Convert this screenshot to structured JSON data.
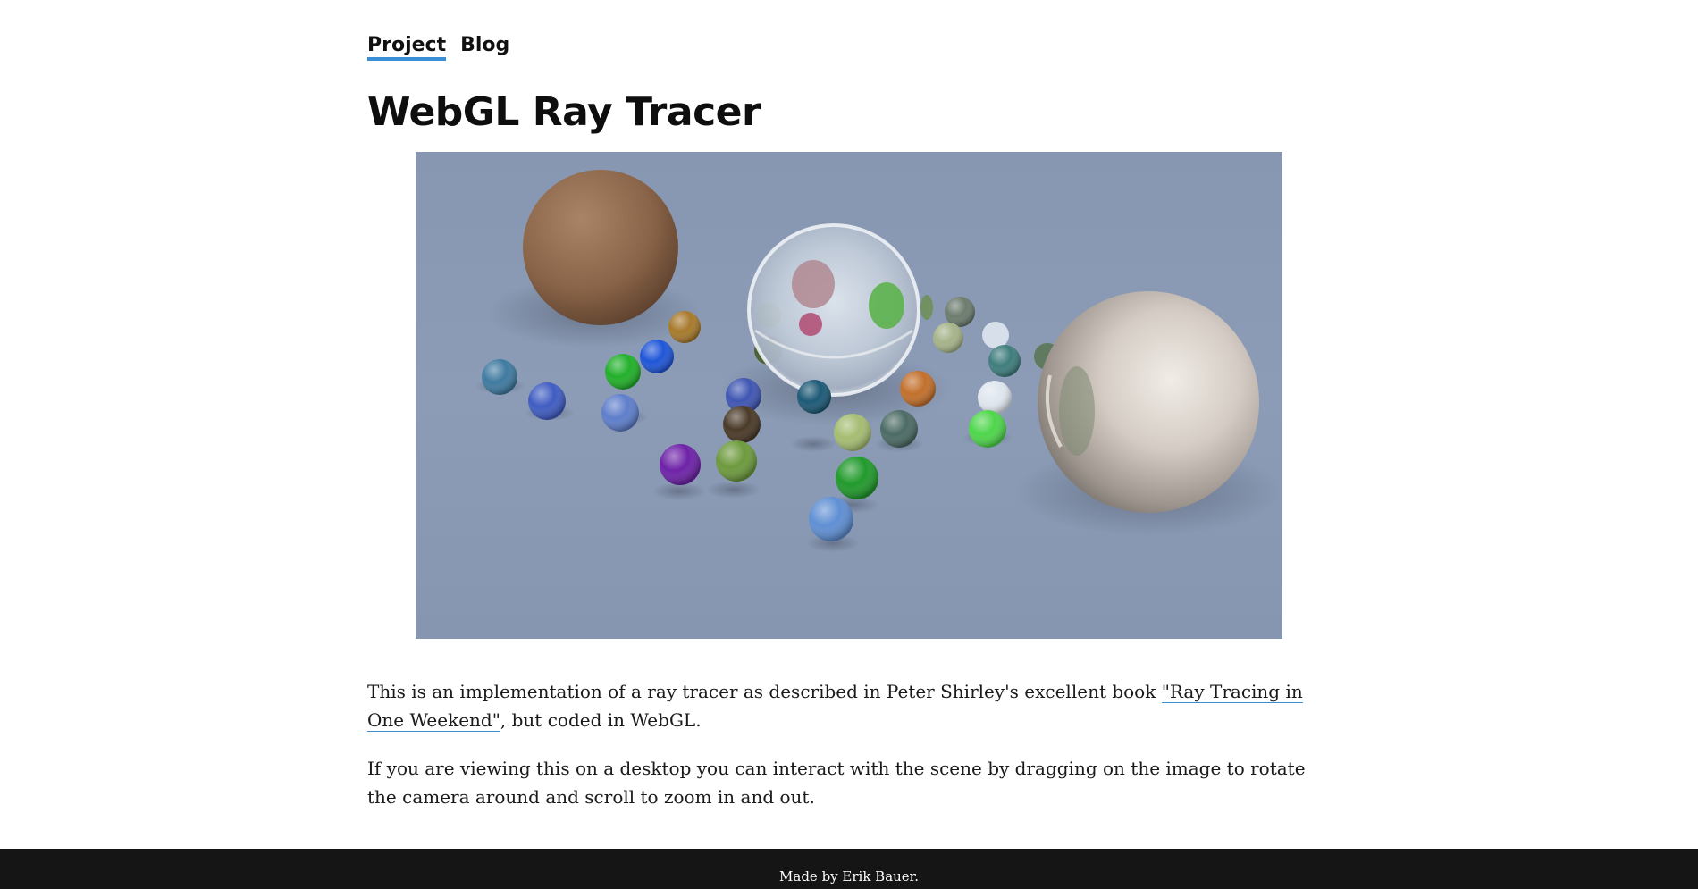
{
  "nav": {
    "items": [
      {
        "label": "Project",
        "active": true
      },
      {
        "label": "Blog",
        "active": false
      }
    ]
  },
  "page": {
    "title": "WebGL Ray Tracer"
  },
  "content": {
    "p1_before": "This is an implementation of a ray tracer as described in Peter Shirley's excellent book ",
    "p1_link": "\"Ray Tracing in One Weekend\"",
    "p1_after": ", but coded in WebGL.",
    "p2": "If you are viewing this on a desktop you can interact with the scene by dragging on the image to rotate the camera around and scroll to zoom in and out."
  },
  "footer": {
    "text": "Made by Erik Bauer."
  },
  "colors": {
    "accent": "#3b8fd6",
    "scene_background": "#8a9ab4",
    "footer_background": "#151515"
  }
}
